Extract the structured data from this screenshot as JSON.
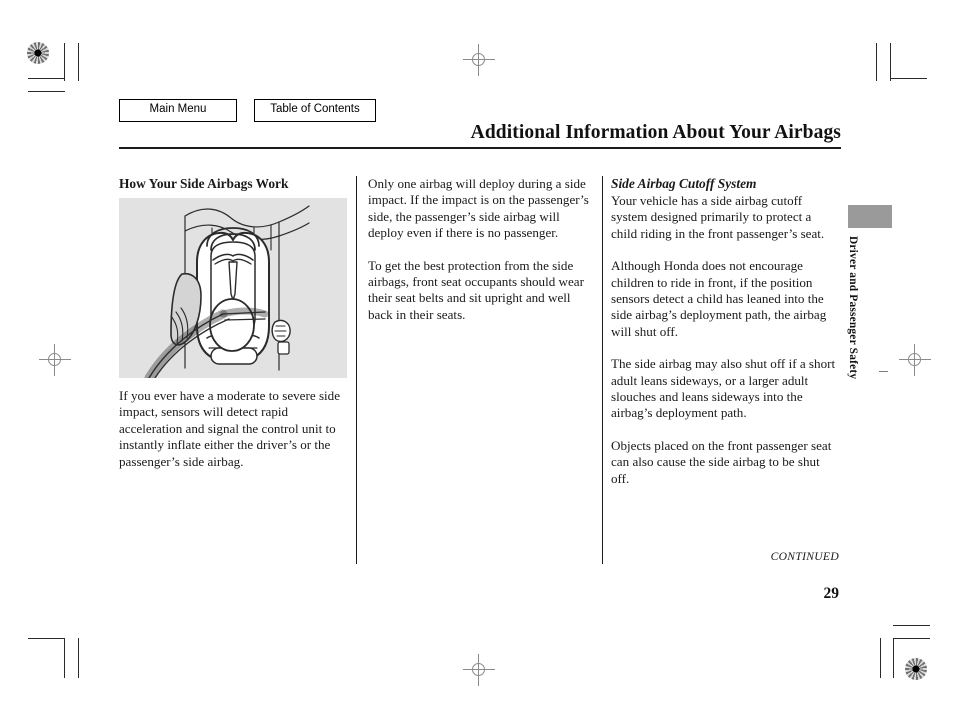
{
  "nav": {
    "main_menu": "Main Menu",
    "table_of_contents": "Table of Contents"
  },
  "header": {
    "title": "Additional Information About Your Airbags"
  },
  "columns": {
    "col1": {
      "heading": "How Your Side Airbags Work",
      "figure_caption": "",
      "paragraph_1": "If you ever have a moderate to severe side impact, sensors will detect rapid acceleration and signal the control unit to instantly inflate either the driver’s or the passenger’s side airbag."
    },
    "col2": {
      "paragraph_1": "Only one airbag will deploy during a side impact. If the impact is on the passenger’s side, the passenger’s side airbag will deploy even if there is no passenger.",
      "paragraph_2": "To get the best protection from the side airbags, front seat occupants should wear their seat belts and sit upright and well back in their seats."
    },
    "col3": {
      "heading": "Side Airbag Cutoff System",
      "paragraph_1": "Your vehicle has a side airbag cutoff system designed primarily to protect a child riding in the front passenger’s seat.",
      "paragraph_2": "Although Honda does not encourage children to ride in front, if the position sensors detect a child has leaned into the side airbag’s deployment path, the airbag will shut off.",
      "paragraph_3": "The side airbag may also shut off if a short adult leans sideways, or a larger adult slouches and leans sideways into the airbag’s deployment path.",
      "paragraph_4": "Objects placed on the front passenger seat can also cause the side airbag to be shut off."
    }
  },
  "side_tab": {
    "label": "Driver and Passenger Safety"
  },
  "footer": {
    "continued": "CONTINUED",
    "page_number": "29"
  },
  "colors": {
    "figure_background": "#e2e2e2",
    "side_tab_block": "#9a9a9a",
    "rule": "#1a1a1a",
    "text": "#1a1a1a"
  }
}
